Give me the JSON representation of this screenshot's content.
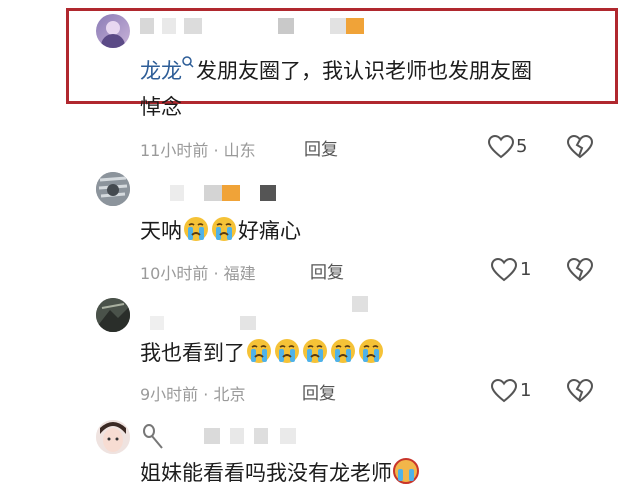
{
  "comments": [
    {
      "mention": "龙龙",
      "text": "发朋友圈了，我认识老师也发朋友圈",
      "text_line2": "悼念",
      "time": "11小时前",
      "location": "山东",
      "reply": "回复",
      "likes": "5"
    },
    {
      "text": "天呐",
      "text_after": "好痛心",
      "time": "10小时前",
      "location": "福建",
      "reply": "回复",
      "likes": "1"
    },
    {
      "text": "我也看到了",
      "time": "9小时前",
      "location": "北京",
      "reply": "回复",
      "likes": "1"
    },
    {
      "text": "姐妹能看看吗我没有龙老师"
    }
  ],
  "separator": " · ",
  "icons": {
    "like": "heart-outline-icon",
    "dislike": "broken-heart-icon",
    "emoji": "crying-face-emoji",
    "search": "search-icon"
  },
  "colors": {
    "highlight": "#b0282e",
    "mention": "#2d5d97",
    "meta": "#9a9a9a"
  }
}
